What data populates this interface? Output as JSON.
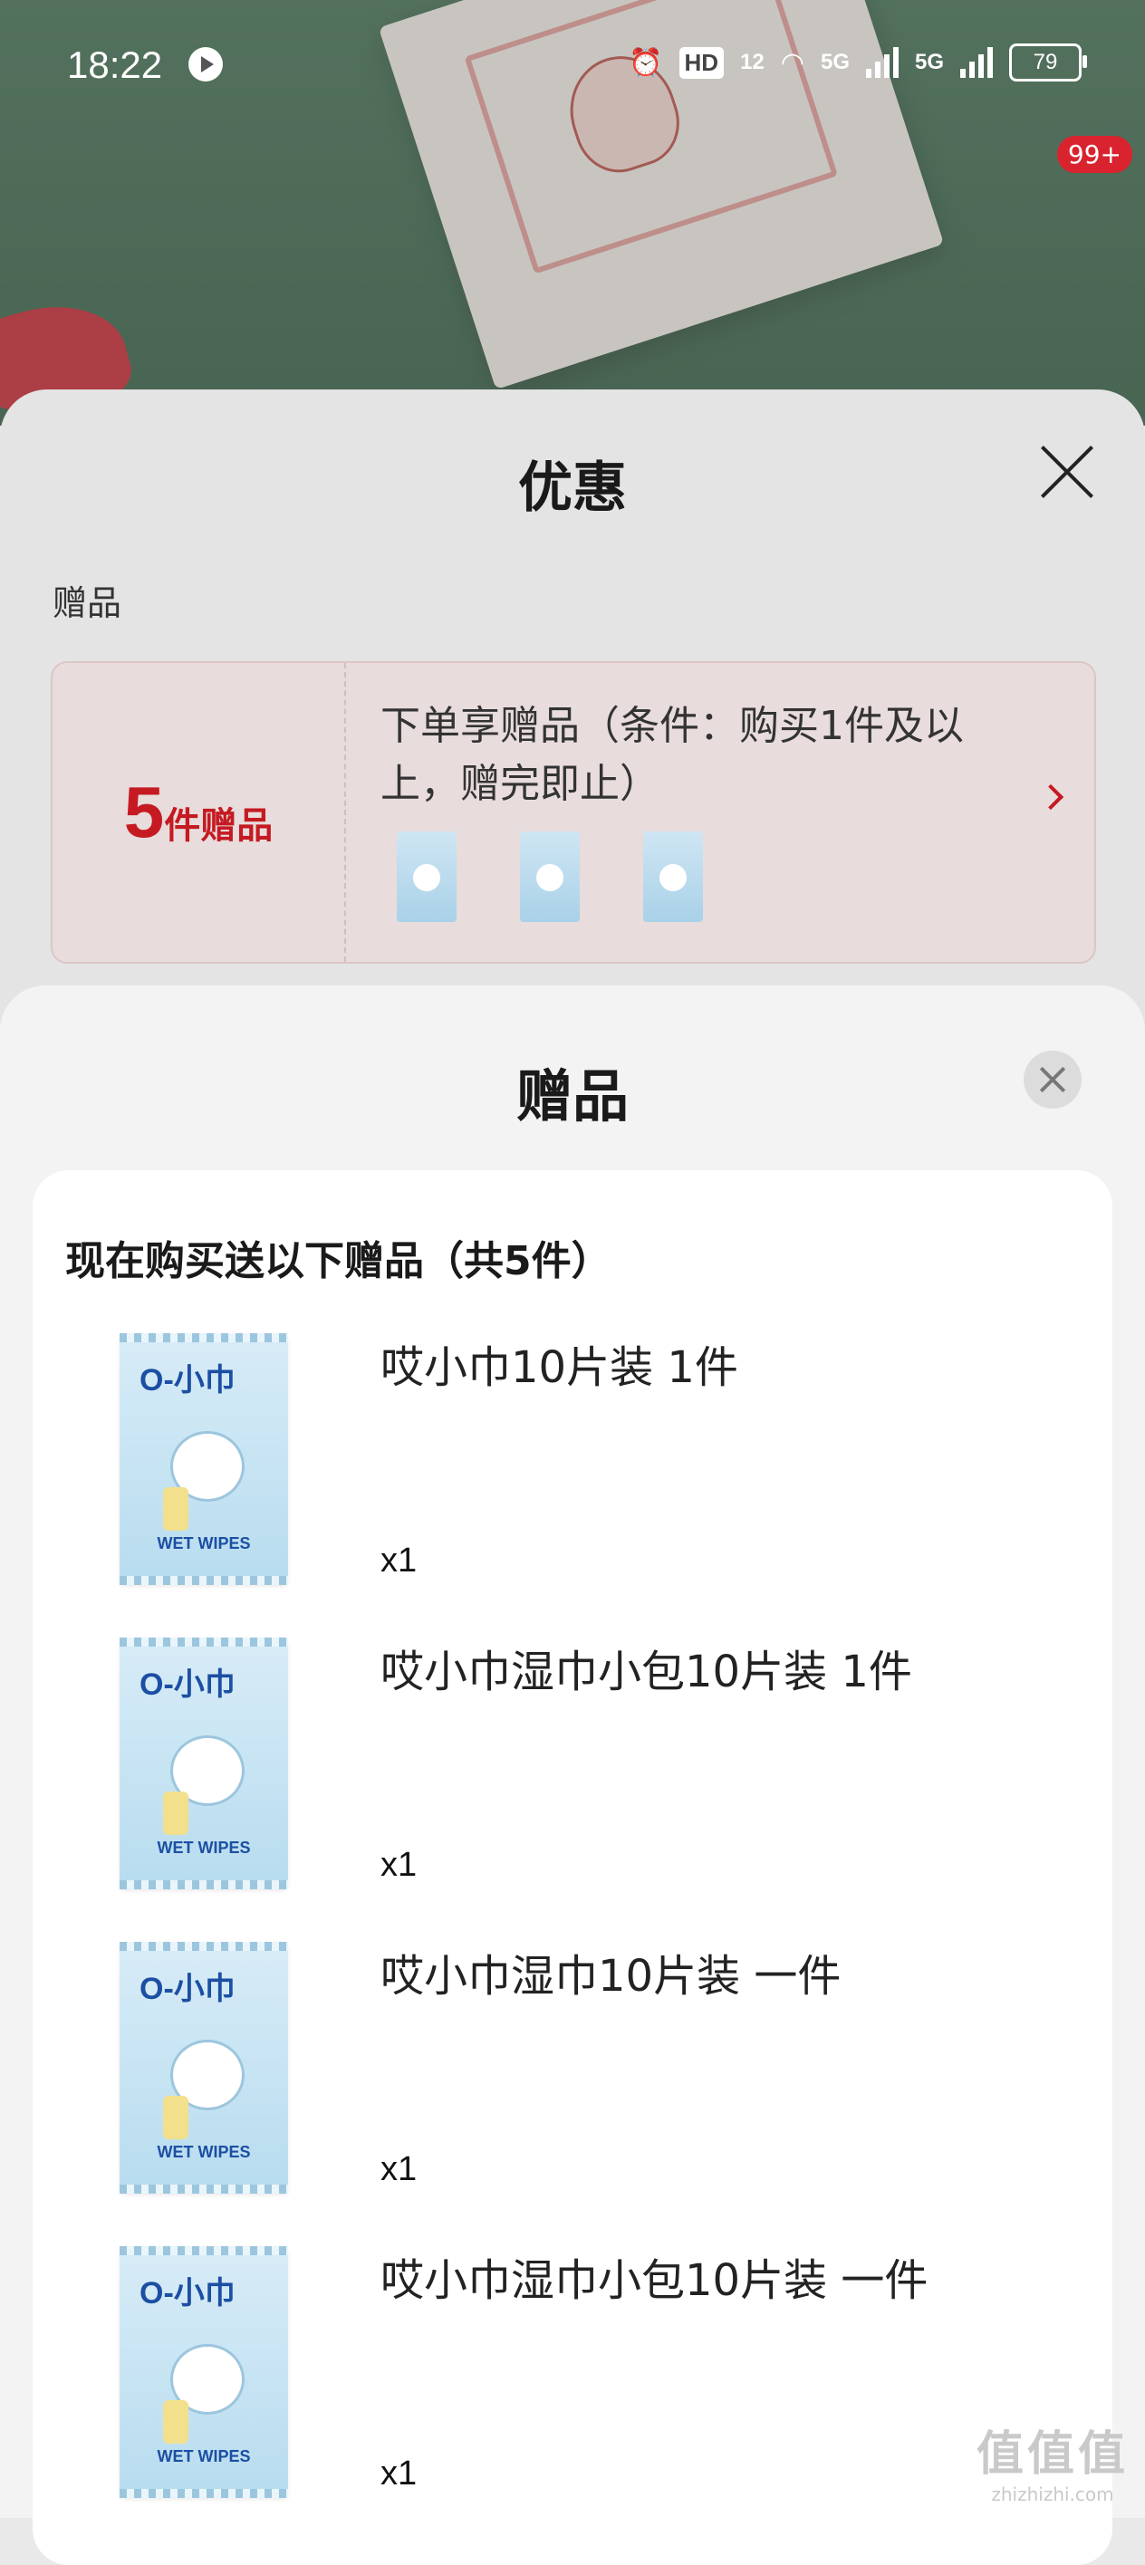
{
  "status_bar": {
    "time": "18:22",
    "hd": "HD",
    "hd_sub": "12",
    "signal1": "5G",
    "signal2": "5G",
    "battery": "79"
  },
  "badge": "99+",
  "discount_sheet": {
    "title": "优惠",
    "section_label": "赠品",
    "gift_card": {
      "count": "5",
      "count_unit": "件赠品",
      "description": "下单享赠品（条件：购买1件及以上，赠完即止）"
    }
  },
  "gift_sheet": {
    "title": "赠品",
    "heading": "现在购买送以下赠品（共5件）",
    "items": [
      {
        "name": "哎小巾10片装 1件",
        "qty": "x1"
      },
      {
        "name": "哎小巾湿巾小包10片装 1件",
        "qty": "x1"
      },
      {
        "name": "哎小巾湿巾10片装 一件",
        "qty": "x1"
      },
      {
        "name": "哎小巾湿巾小包10片装 一件",
        "qty": "x1"
      }
    ],
    "product_brand": "O-小巾",
    "product_label": "WET WIPES"
  },
  "watermark": {
    "text": "值值值",
    "url": "zhizhizhi.com"
  },
  "colors": {
    "accent": "#c51a22",
    "sheet_bg": "#f3f3f3"
  }
}
